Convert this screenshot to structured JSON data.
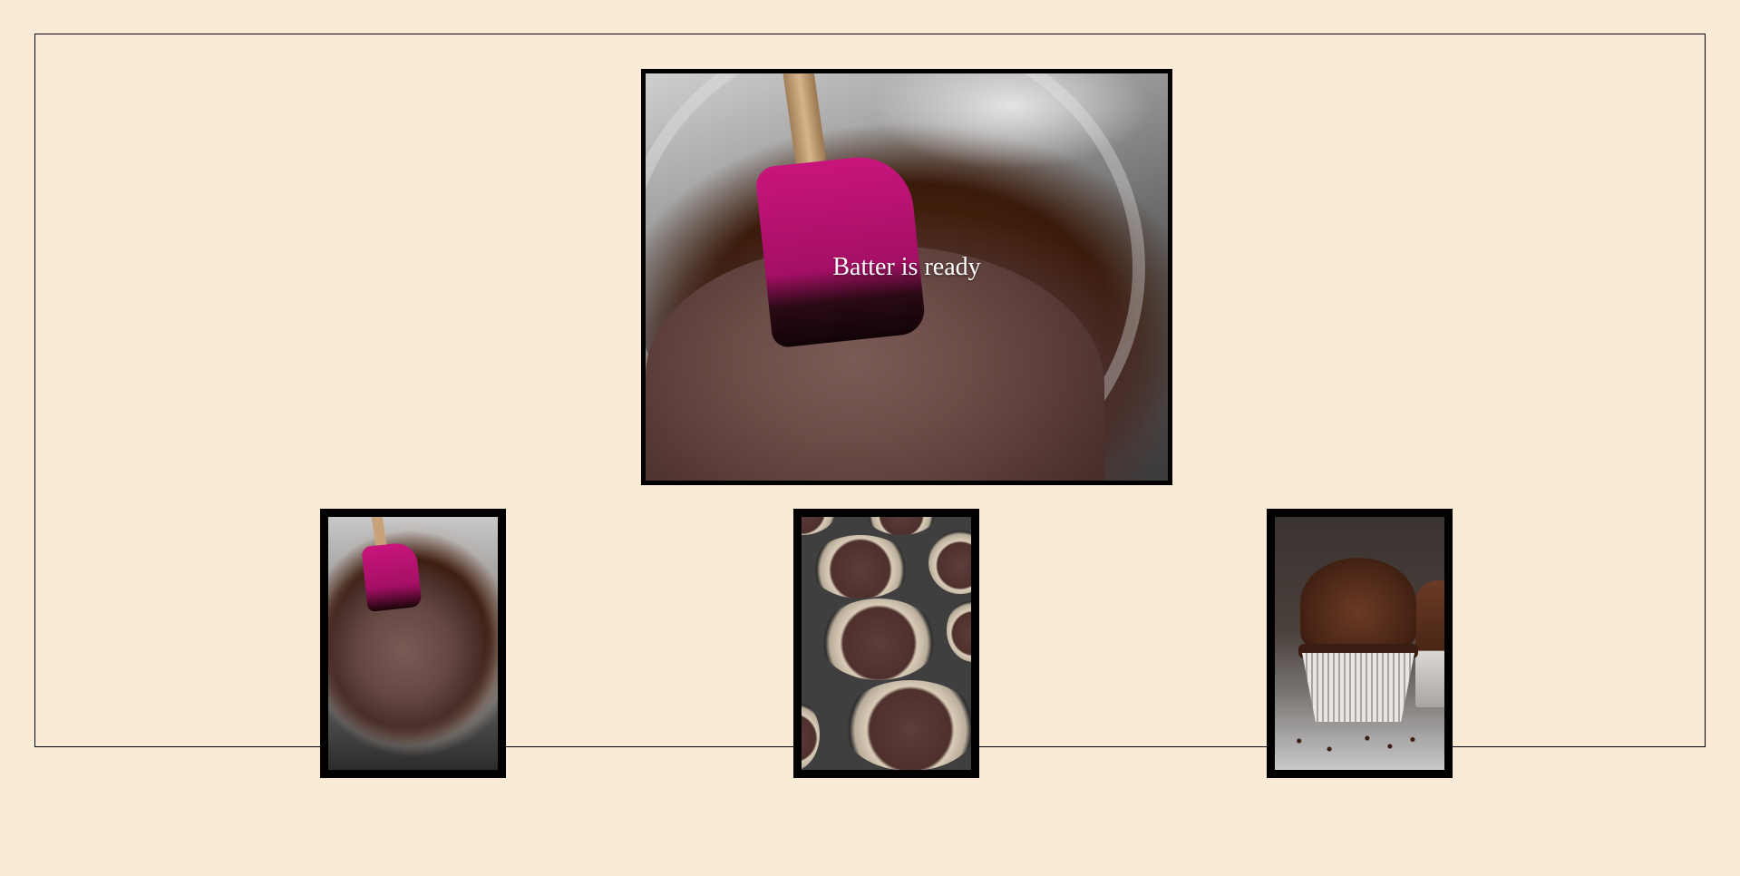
{
  "gallery": {
    "hero": {
      "caption": "Batter is ready",
      "image": "chocolate-batter-bowl-with-pink-spatula"
    },
    "thumbnails": [
      {
        "image": "chocolate-batter-bowl"
      },
      {
        "image": "batter-in-cupcake-pan"
      },
      {
        "image": "frosted-chocolate-cupcake"
      }
    ]
  },
  "colors": {
    "page_background": "#faebd7",
    "frame": "#000000",
    "caption_text": "#ffffff"
  }
}
